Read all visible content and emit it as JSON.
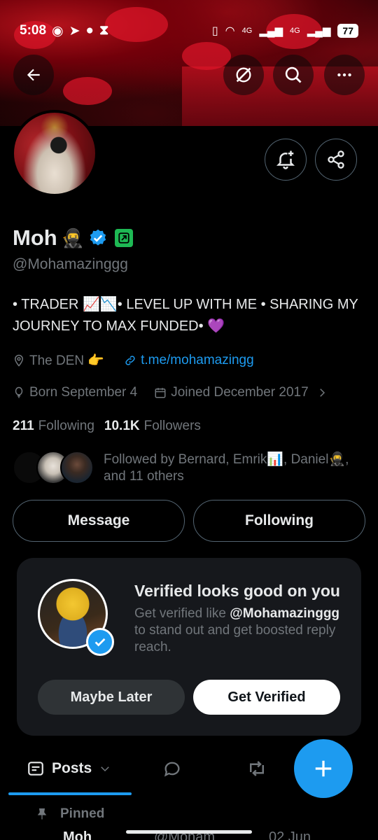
{
  "status_bar": {
    "time": "5:08",
    "network_1": "4G",
    "network_2": "4G",
    "battery": "77"
  },
  "profile": {
    "name": "Moh",
    "handle": "@Mohamazinggg",
    "bio": "• TRADER 📈📉• LEVEL UP WITH ME • SHARING MY JOURNEY TO MAX FUNDED• 💜",
    "location": "The DEN 👉",
    "link": "t.me/mohamazingg",
    "born": "Born September 4",
    "joined": "Joined December 2017",
    "following_count": "211",
    "following_label": "Following",
    "followers_count": "10.1K",
    "followers_label": "Followers",
    "followed_by": "Followed by Bernard, Emrik📊, Daniel🥷, and 11 others"
  },
  "actions": {
    "message": "Message",
    "following": "Following"
  },
  "verified_card": {
    "title": "Verified looks good on you",
    "text_before": "Get verified like",
    "handle": "@Mohamazinggg",
    "text_after": "to stand out and get boosted reply reach.",
    "maybe_later": "Maybe Later",
    "get_verified": "Get Verified"
  },
  "tabs": {
    "posts": "Posts"
  },
  "pinned": {
    "label": "Pinned",
    "peek_name": "Moh",
    "peek_handle": "@Moham",
    "peek_date": "02 Jun"
  },
  "colors": {
    "accent": "#1d9bf0",
    "background": "#000000",
    "card": "#16181c",
    "muted": "#71767b"
  },
  "icons": [
    "back-arrow-icon",
    "grok-icon",
    "search-icon",
    "more-icon",
    "notification-add-icon",
    "share-icon",
    "verified-badge-icon",
    "affiliate-badge-icon",
    "location-icon",
    "link-icon",
    "balloon-icon",
    "calendar-icon",
    "chevron-right-icon",
    "posts-icon",
    "chevron-down-icon",
    "replies-icon",
    "reposts-icon",
    "plus-icon",
    "pin-icon"
  ]
}
